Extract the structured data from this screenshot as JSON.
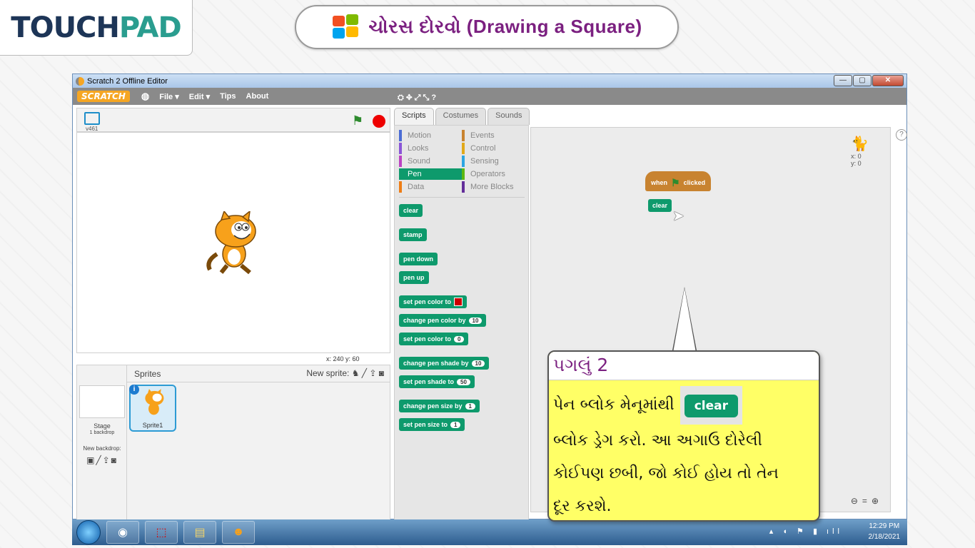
{
  "header": {
    "logo_prefix": "TOUCH",
    "logo_suffix": "PAD",
    "title": "ચોરસ દોરવો (Drawing a Square)"
  },
  "window": {
    "title": "Scratch 2 Offline Editor",
    "controls": [
      "—",
      "▢",
      "✕"
    ]
  },
  "menubar": {
    "logo": "SCRATCH",
    "items": [
      "File ▾",
      "Edit ▾",
      "Tips",
      "About"
    ],
    "tools": "⛭ ✥ ⤢ ⤡ ?"
  },
  "stage": {
    "version": "v461",
    "coords": "x: 240  y: 60"
  },
  "sprites_pane": {
    "title": "Sprites",
    "new_sprite": "New sprite:",
    "stage_label": "Stage",
    "backdrop_count": "1 backdrop",
    "new_backdrop": "New backdrop:",
    "sprite_name": "Sprite1"
  },
  "tabs": [
    "Scripts",
    "Costumes",
    "Sounds"
  ],
  "categories": [
    {
      "label": "Motion",
      "color": "#4a6cd4"
    },
    {
      "label": "Events",
      "color": "#c88330"
    },
    {
      "label": "Looks",
      "color": "#8a55d7"
    },
    {
      "label": "Control",
      "color": "#e1a91a"
    },
    {
      "label": "Sound",
      "color": "#bb42c3"
    },
    {
      "label": "Sensing",
      "color": "#2ca5e2"
    },
    {
      "label": "Pen",
      "color": "#0e9a6c"
    },
    {
      "label": "Operators",
      "color": "#5cb712"
    },
    {
      "label": "Data",
      "color": "#ee7d16"
    },
    {
      "label": "More Blocks",
      "color": "#632d99"
    }
  ],
  "blocks": {
    "clear": "clear",
    "stamp": "stamp",
    "pen_down": "pen down",
    "pen_up": "pen up",
    "set_color": "set pen color to",
    "change_color": "change pen color by",
    "change_color_val": "10",
    "set_color_to": "set pen color to",
    "set_color_to_val": "0",
    "change_shade": "change pen shade by",
    "change_shade_val": "10",
    "set_shade": "set pen shade to",
    "set_shade_val": "50",
    "change_size": "change pen size by",
    "change_size_val": "1",
    "set_size": "set pen size to",
    "set_size_val": "1"
  },
  "script": {
    "hat_when": "when",
    "hat_clicked": "clicked",
    "clear": "clear",
    "sprite_x": "x: 0",
    "sprite_y": "y: 0"
  },
  "callout": {
    "step": "પગલું 2",
    "line1": "પેન બ્લોક મેનૂમાંથી",
    "chip": "clear",
    "line2": "બ્લોક ડ્રેગ કરો. આ અગાઉ દોરેલી",
    "line3": "કોઈપણ છબી, જો કોઈ હોય તો તેન",
    "line4": "દૂર કરશે."
  },
  "taskbar": {
    "time": "12:29 PM",
    "date": "2/18/2021"
  },
  "colors": {
    "pen_green": "#0e9a6c",
    "events_orange": "#c88330",
    "callout_yellow": "#ffff66",
    "title_purple": "#7b2080"
  }
}
